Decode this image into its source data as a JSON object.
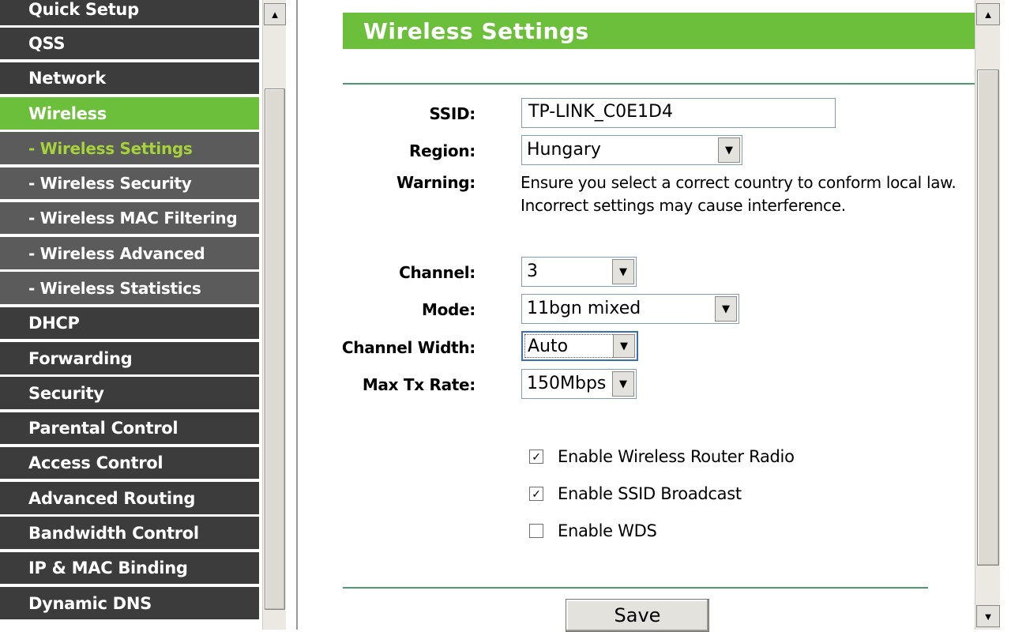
{
  "nav": {
    "items": [
      {
        "label": "Quick Setup",
        "type": "main"
      },
      {
        "label": "QSS",
        "type": "main"
      },
      {
        "label": "Network",
        "type": "main"
      },
      {
        "label": "Wireless",
        "type": "active"
      },
      {
        "label": "- Wireless Settings",
        "type": "sub-current"
      },
      {
        "label": "- Wireless Security",
        "type": "sub"
      },
      {
        "label": "- Wireless MAC Filtering",
        "type": "sub"
      },
      {
        "label": "- Wireless Advanced",
        "type": "sub"
      },
      {
        "label": "- Wireless Statistics",
        "type": "sub"
      },
      {
        "label": "DHCP",
        "type": "main"
      },
      {
        "label": "Forwarding",
        "type": "main"
      },
      {
        "label": "Security",
        "type": "main"
      },
      {
        "label": "Parental Control",
        "type": "main"
      },
      {
        "label": "Access Control",
        "type": "main"
      },
      {
        "label": "Advanced Routing",
        "type": "main"
      },
      {
        "label": "Bandwidth Control",
        "type": "main"
      },
      {
        "label": "IP & MAC Binding",
        "type": "main"
      },
      {
        "label": "Dynamic DNS",
        "type": "main"
      }
    ]
  },
  "page": {
    "title": "Wireless Settings"
  },
  "form": {
    "ssid_label": "SSID:",
    "ssid_value": "TP-LINK_C0E1D4",
    "region_label": "Region:",
    "region_value": "Hungary",
    "warning_label": "Warning:",
    "warning_line1": "Ensure you select a correct country to conform local law.",
    "warning_line2": "Incorrect settings may cause interference.",
    "channel_label": "Channel:",
    "channel_value": "3",
    "mode_label": "Mode:",
    "mode_value": "11bgn mixed",
    "width_label": "Channel Width:",
    "width_value": "Auto",
    "rate_label": "Max Tx Rate:",
    "rate_value": "150Mbps",
    "checkboxes": [
      {
        "label": "Enable Wireless Router Radio",
        "checked": true
      },
      {
        "label": "Enable SSID Broadcast",
        "checked": true
      },
      {
        "label": "Enable WDS",
        "checked": false
      }
    ],
    "save_label": "Save"
  },
  "colors": {
    "accent_green": "#6cbf3b",
    "nav_dark": "#3c3c3c",
    "nav_sub": "#5b5b5b",
    "current_sub_text": "#a6d23a"
  },
  "icons": {
    "scroll_up": "triangle-up-icon",
    "scroll_down": "triangle-down-icon",
    "dropdown": "triangle-down-icon",
    "check": "checkmark-icon"
  }
}
